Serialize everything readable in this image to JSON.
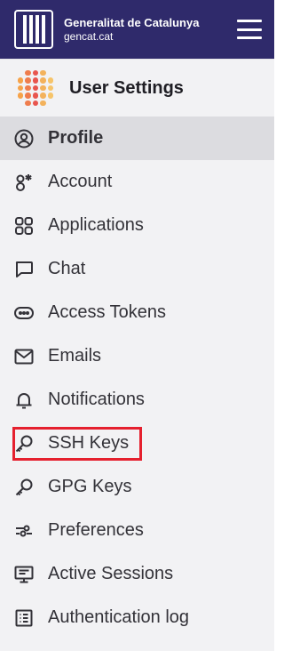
{
  "header": {
    "brand_title": "Generalitat de Catalunya",
    "brand_subtitle": "gencat.cat",
    "menu_icon": "hamburger-icon",
    "background": "#2f2a6b"
  },
  "sidebar": {
    "title": "User Settings",
    "avatar_icon": "dotted-pattern-icon",
    "active_background": "#dcdce0",
    "items": [
      {
        "label": "Profile",
        "icon": "profile-icon",
        "active": true
      },
      {
        "label": "Account",
        "icon": "account-icon"
      },
      {
        "label": "Applications",
        "icon": "applications-icon"
      },
      {
        "label": "Chat",
        "icon": "chat-icon"
      },
      {
        "label": "Access Tokens",
        "icon": "token-icon"
      },
      {
        "label": "Emails",
        "icon": "envelope-icon"
      },
      {
        "label": "Notifications",
        "icon": "bell-icon"
      },
      {
        "label": "SSH Keys",
        "icon": "key-icon",
        "highlighted": true
      },
      {
        "label": "GPG Keys",
        "icon": "key-icon"
      },
      {
        "label": "Preferences",
        "icon": "preferences-icon"
      },
      {
        "label": "Active Sessions",
        "icon": "monitor-icon"
      },
      {
        "label": "Authentication log",
        "icon": "log-icon"
      }
    ]
  },
  "annotation": {
    "highlight_color": "#e5202e"
  }
}
